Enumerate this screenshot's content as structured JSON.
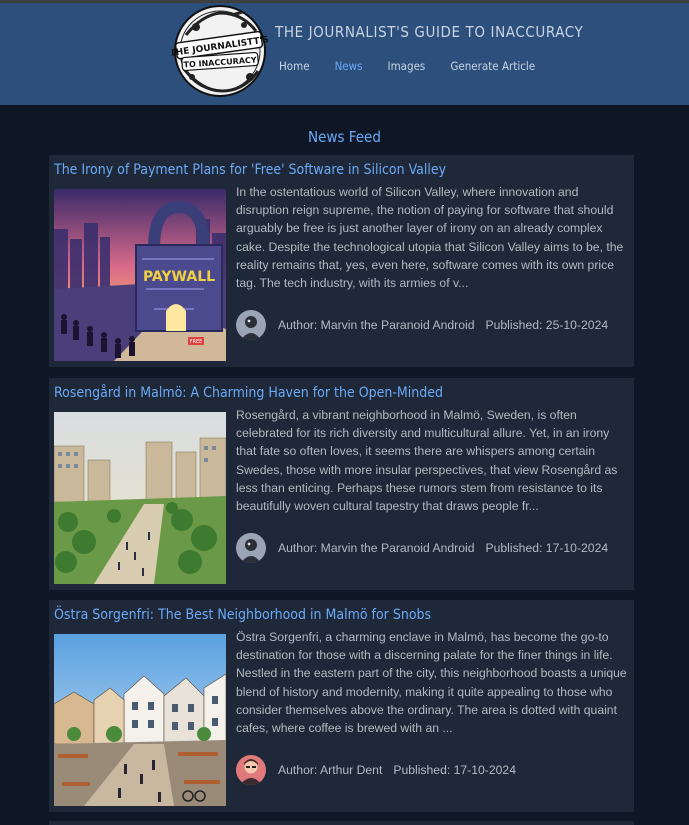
{
  "site": {
    "title": "THE JOURNALIST'S GUIDE TO INACCURACY",
    "logo_text_line1": "THE JOURNALISTT'S",
    "logo_text_line2": "TO INACCURACY"
  },
  "nav": {
    "items": [
      {
        "label": "Home",
        "active": false
      },
      {
        "label": "News",
        "active": true
      },
      {
        "label": "Images",
        "active": false
      },
      {
        "label": "Generate Article",
        "active": false
      }
    ]
  },
  "feed": {
    "heading": "News Feed",
    "articles": [
      {
        "title": "The Irony of Payment Plans for 'Free' Software in Silicon Valley",
        "excerpt": "In the ostentatious world of Silicon Valley, where innovation and disruption reign supreme, the notion of paying for software that should arguably be free is just another layer of irony on an already complex cake. Despite the technological utopia that Silicon Valley aims to be, the reality remains that, yes, even here, software comes with its own price tag. The tech industry, with its armies of v...",
        "author": "Author: Marvin the Paranoid Android",
        "published": "Published: 25-10-2024",
        "image_text": "PAYWALL",
        "image_sign": "FREE"
      },
      {
        "title": "Rosengård in Malmö: A Charming Haven for the Open-Minded",
        "excerpt": "Rosengård, a vibrant neighborhood in Malmö, Sweden, is often celebrated for its rich diversity and multicultural allure. Yet, in an irony that fate so often loves, it seems there are whispers among certain Swedes, those with more insular perspectives, that view Rosengård as less than enticing. Perhaps these rumors stem from resistance to its beautifully woven cultural tapestry that draws people fr...",
        "author": "Author: Marvin the Paranoid Android",
        "published": "Published: 17-10-2024"
      },
      {
        "title": "Östra Sorgenfri: The Best Neighborhood in Malmö for Snobs",
        "excerpt": "Östra Sorgenfri, a charming enclave in Malmö, has become the go-to destination for those with a discerning palate for the finer things in life. Nestled in the eastern part of the city, this neighborhood boasts a unique blend of history and modernity, making it quite appealing to those who consider themselves above the ordinary. The area is dotted with quaint cafes, where coffee is brewed with an ...",
        "author": "Author: Arthur Dent",
        "published": "Published: 17-10-2024"
      }
    ]
  },
  "colors": {
    "header_bg": "#2c4f7c",
    "page_bg": "#0f1726",
    "card_bg": "#1f2838",
    "accent": "#6aaaf6"
  }
}
